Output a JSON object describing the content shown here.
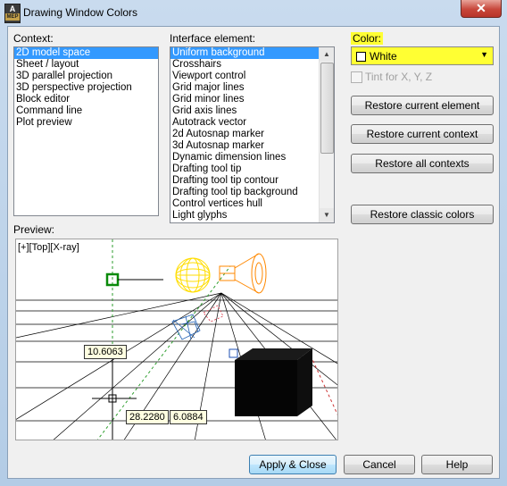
{
  "window": {
    "title": "Drawing Window Colors",
    "app_icon_letter": "A",
    "app_icon_sub": "MEP",
    "close_glyph": "✕"
  },
  "context": {
    "label": "Context:",
    "items": [
      "2D model space",
      "Sheet / layout",
      "3D parallel projection",
      "3D perspective projection",
      "Block editor",
      "Command line",
      "Plot preview"
    ],
    "selected_index": 0
  },
  "interface_element": {
    "label": "Interface element:",
    "items": [
      "Uniform background",
      "Crosshairs",
      "Viewport control",
      "Grid major lines",
      "Grid minor lines",
      "Grid axis lines",
      "Autotrack vector",
      "2d Autosnap marker",
      "3d Autosnap marker",
      "Dynamic dimension lines",
      "Drafting tool tip",
      "Drafting tool tip contour",
      "Drafting tool tip background",
      "Control vertices hull",
      "Light glyphs"
    ],
    "selected_index": 0
  },
  "color": {
    "label": "Color:",
    "value": "White",
    "swatch_color": "#ffffff",
    "highlight_color": "#ffff33",
    "tint_label": "Tint for X, Y, Z",
    "tint_checked": false,
    "tint_enabled": false
  },
  "buttons": {
    "restore_current_element": "Restore current element",
    "restore_current_context": "Restore current context",
    "restore_all_contexts": "Restore all contexts",
    "restore_classic_colors": "Restore classic colors",
    "apply_close": "Apply & Close",
    "cancel": "Cancel",
    "help": "Help"
  },
  "preview": {
    "label": "Preview:",
    "viewport_label": "[+][Top][X-ray]",
    "dim_value_1": "10.6063",
    "dim_value_2": "28.2280",
    "dim_value_3": "6.0884"
  },
  "colors": {
    "selection": "#3399ff",
    "grid": "#000000",
    "axis_green": "#2e9e2e",
    "axis_red": "#cc3333",
    "light_yellow": "#ffee00",
    "light_orange": "#ff8800"
  }
}
